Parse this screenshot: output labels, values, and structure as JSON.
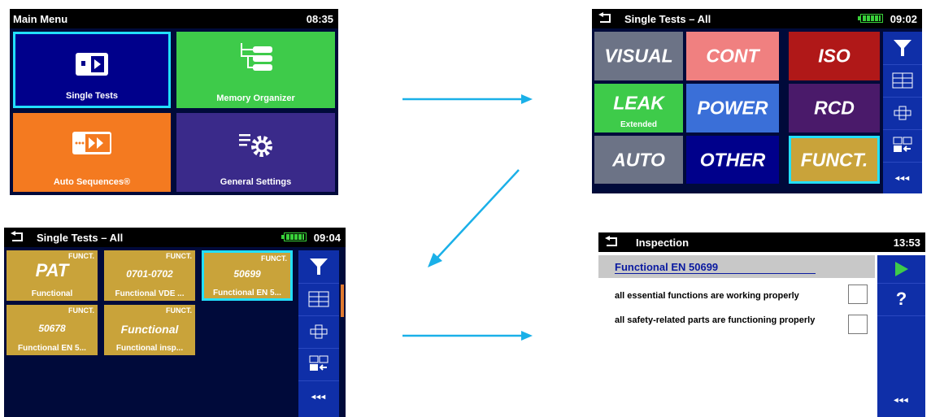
{
  "main_menu": {
    "title": "Main Menu",
    "time": "08:35",
    "tiles": [
      {
        "label": "Single Tests",
        "color": "#00008b",
        "icon": "single-tests-icon"
      },
      {
        "label": "Memory Organizer",
        "color": "#3ecb4a",
        "icon": "memory-tree-icon"
      },
      {
        "label": "Auto Sequences®",
        "color": "#f47a20",
        "icon": "auto-sequences-icon"
      },
      {
        "label": "General Settings",
        "color": "#3a2a8a",
        "icon": "settings-gear-icon"
      }
    ]
  },
  "single_tests_all": {
    "title": "Single Tests – All",
    "time": "09:02",
    "tiles": [
      {
        "label": "VISUAL",
        "sub": "",
        "color": "#6c7386"
      },
      {
        "label": "CONT",
        "sub": "",
        "color": "#f08080"
      },
      {
        "label": "ISO",
        "sub": "",
        "color": "#b01818"
      },
      {
        "label": "LEAK",
        "sub": "Extended",
        "color": "#3ecb4a"
      },
      {
        "label": "POWER",
        "sub": "",
        "color": "#3a6fd8"
      },
      {
        "label": "RCD",
        "sub": "",
        "color": "#4a1a6a"
      },
      {
        "label": "AUTO",
        "sub": "",
        "color": "#6c7386"
      },
      {
        "label": "OTHER",
        "sub": "",
        "color": "#00008b"
      },
      {
        "label": "FUNCT.",
        "sub": "",
        "color": "#c9a33a"
      }
    ],
    "more": "◂◂◂"
  },
  "funct_tests": {
    "title": "Single Tests – All",
    "time": "09:04",
    "tiles": [
      {
        "flag": "FUNCT.",
        "main": "PAT",
        "bottom": "Functional"
      },
      {
        "flag": "FUNCT.",
        "main": "0701-0702",
        "bottom": "Functional VDE ..."
      },
      {
        "flag": "FUNCT.",
        "main": "50699",
        "bottom": "Functional EN 5..."
      },
      {
        "flag": "FUNCT.",
        "main": "50678",
        "bottom": "Functional EN 5..."
      },
      {
        "flag": "FUNCT.",
        "main": "Functional",
        "bottom": "Functional insp..."
      }
    ],
    "more": "◂◂◂"
  },
  "inspection": {
    "title": "Inspection",
    "time": "13:53",
    "heading": "Functional EN 50699",
    "items": [
      "all essential functions are working properly",
      "all safety-related parts are functioning properly"
    ],
    "help": "?",
    "more": "◂◂◂"
  },
  "colors": {
    "arrow": "#1ab0e8",
    "sidebar": "#0f2fa8",
    "highlight": "#22e0ff"
  }
}
